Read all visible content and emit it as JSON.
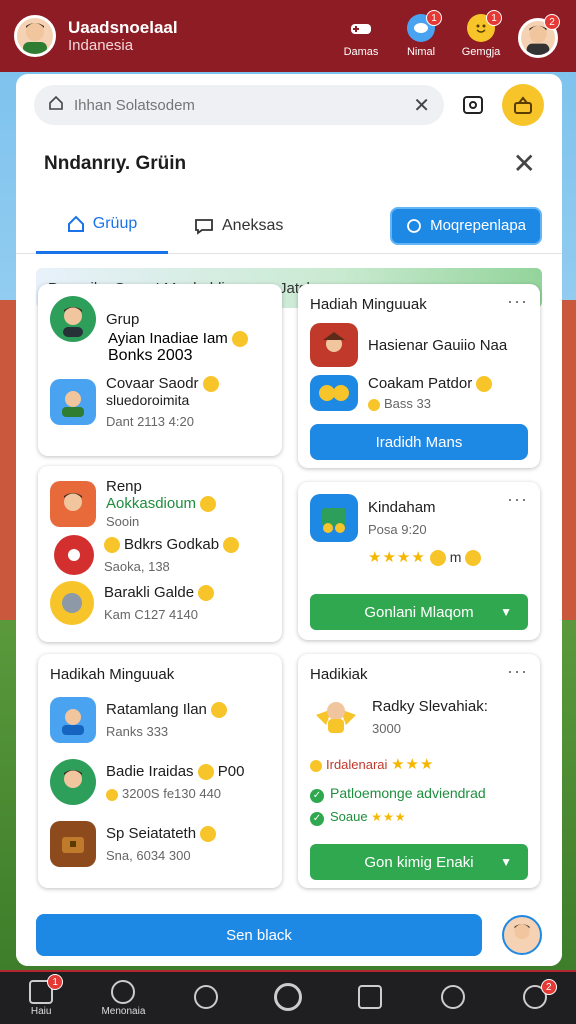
{
  "topbar": {
    "title": "Uaadsnoelaal",
    "subtitle": "Indanesia",
    "actions": [
      {
        "label": "Damas",
        "icon": "game-controller-icon",
        "badge": ""
      },
      {
        "label": "Nimal",
        "icon": "bird-icon",
        "badge": "1"
      },
      {
        "label": "Gemgja",
        "icon": "smiley-icon",
        "badge": "1"
      }
    ],
    "profile_badge": "2"
  },
  "search": {
    "placeholder": "Ihhan Solatsodem"
  },
  "dialog": {
    "title": "Nndanrıy. Grüin"
  },
  "tabs": {
    "active": "Grüup",
    "second": "Aneksas",
    "action_button": "Moqrepenlapa"
  },
  "banner": "Pnpesika Grup, I Manhahlioguoun Jatsk",
  "cards": {
    "grup": {
      "title": "Grup",
      "items": [
        {
          "name": "Ayian Inadiae Iam",
          "sub": "Bonks 2003"
        },
        {
          "name": "Covaar Saodr",
          "name2": "sluedoroimita",
          "sub": "Dant 2113 4:20"
        }
      ]
    },
    "hadiah": {
      "title": "Hadiah Minguuak",
      "items": [
        {
          "name": "Hasienar Gauiio Naa",
          "sub": ""
        },
        {
          "name": "Coakam Patdor",
          "sub": "Bass 33"
        }
      ],
      "button": "Iradidh Mans"
    },
    "renp": {
      "title": "Renp",
      "items": [
        {
          "name": "Aokkasdioum",
          "sub": "Sooin"
        },
        {
          "name": "Bdkrs Godkab",
          "sub": "Saoka, 138"
        },
        {
          "name": "Barakli Galde",
          "sub": "Kam C127 4140"
        }
      ]
    },
    "kindaham": {
      "title": "Kindaham",
      "sub": "Posa 9:20",
      "rating_text": "m",
      "button": "Gonlani Mlaqom"
    },
    "hadikah": {
      "title": "Hadikah Minguuak",
      "items": [
        {
          "name": "Ratamlang Ilan",
          "sub": "Ranks 333"
        },
        {
          "name": "Badie Iraidas",
          "name2": "P00",
          "sub": "3200S fe130 440"
        },
        {
          "name": "Sp Seiatateth",
          "sub": "Sna, 6034 300"
        }
      ]
    },
    "hadikiak": {
      "title": "Hadikiak",
      "item": {
        "name": "Radky Slevahiak:",
        "sub": "3000"
      },
      "line1": "Irdalenarai",
      "line2": "Patloemonge adviendrad",
      "line3": "Soaue",
      "button": "Gon kimig Enaki"
    }
  },
  "bottom_button": "Sen black",
  "bottom_nav": [
    {
      "label": "Haiu",
      "badge": "1"
    },
    {
      "label": "Menonaia",
      "badge": ""
    },
    {
      "label": "",
      "badge": ""
    },
    {
      "label": "",
      "badge": ""
    },
    {
      "label": "",
      "badge": ""
    },
    {
      "label": "",
      "badge": ""
    },
    {
      "label": "",
      "badge": "2"
    }
  ]
}
